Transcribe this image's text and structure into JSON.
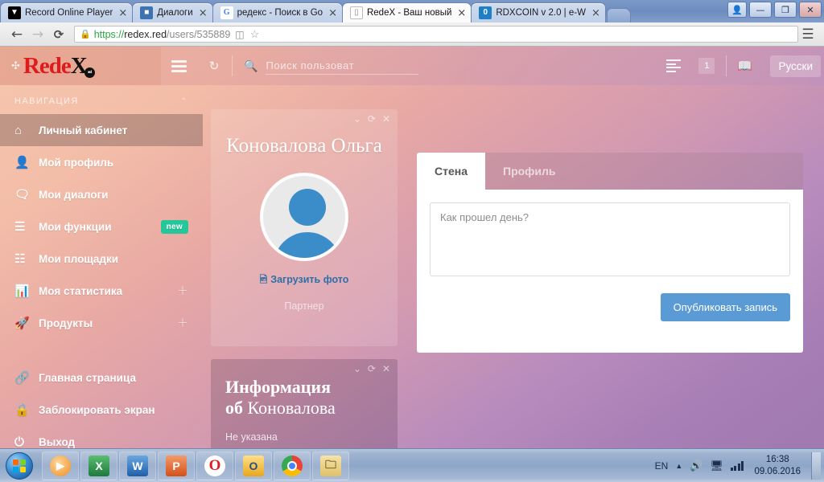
{
  "browser": {
    "tabs": [
      {
        "title": "Record Online Player",
        "favicon": "record-icon",
        "active": false
      },
      {
        "title": "Диалоги",
        "favicon": "dialog-icon",
        "active": false
      },
      {
        "title": "редекс - Поиск в Go",
        "favicon": "google-icon",
        "active": false
      },
      {
        "title": "RedeX - Ваш новый",
        "favicon": "document-icon",
        "active": true
      },
      {
        "title": "RDXCOIN v 2.0 | e-W",
        "favicon": "rdxcoin-icon",
        "active": false
      }
    ],
    "window_controls": {
      "user": "👤",
      "minimize": "—",
      "maximize": "❐",
      "close": "✕"
    },
    "nav": {
      "back": "←",
      "forward": "→",
      "reload": "⟳"
    },
    "url": {
      "scheme": "https://",
      "host": "redex.red",
      "path": "/users/535889"
    },
    "omnibox_icons": {
      "lock": "lock-icon",
      "split": "split-view-icon",
      "star": "bookmark-star-icon",
      "menu": "chrome-menu-icon"
    }
  },
  "header": {
    "logo": {
      "prefix": "Rede",
      "suffix": "X",
      "dot": "red"
    },
    "hamburger": "menu-icon",
    "refresh": "↻",
    "search": {
      "placeholder": "Поиск пользоват",
      "value": "",
      "icon": "search-icon"
    },
    "news_badge": "1",
    "language": "Русски"
  },
  "sidebar": {
    "title": "НАВИГАЦИЯ",
    "collapse": "⌃",
    "items": [
      {
        "label": "Личный кабинет",
        "icon": "home-icon",
        "active": true,
        "badge": "",
        "plus": false
      },
      {
        "label": "Мой профиль",
        "icon": "user-icon",
        "active": false,
        "badge": "",
        "plus": false
      },
      {
        "label": "Мои диалоги",
        "icon": "chat-icon",
        "active": false,
        "badge": "",
        "plus": false
      },
      {
        "label": "Мои функции",
        "icon": "list-icon",
        "active": false,
        "badge": "new",
        "plus": false
      },
      {
        "label": "Мои площадки",
        "icon": "grid-icon",
        "active": false,
        "badge": "",
        "plus": false
      },
      {
        "label": "Моя статистика",
        "icon": "chart-icon",
        "active": false,
        "badge": "",
        "plus": true
      },
      {
        "label": "Продукты",
        "icon": "rocket-icon",
        "active": false,
        "badge": "",
        "plus": true
      }
    ],
    "bottom_items": [
      {
        "label": "Главная страница",
        "icon": "link-icon"
      },
      {
        "label": "Заблокировать экран",
        "icon": "lock-icon"
      },
      {
        "label": "Выход",
        "icon": "power-icon"
      }
    ]
  },
  "profile_card": {
    "name": "Коновалова Ольга",
    "upload_label": "Загрузить фото",
    "upload_icon": "image-icon",
    "role": "Партнер",
    "tools": {
      "collapse": "⌄",
      "refresh": "⟳",
      "close": "✕"
    },
    "avatar": "default-avatar"
  },
  "info_card": {
    "title_bold": "Информация",
    "title_bold2": "об",
    "title_light": "Коновалова",
    "value": "Не указана",
    "tools": {
      "collapse": "⌄",
      "refresh": "⟳",
      "close": "✕"
    }
  },
  "wall": {
    "tabs": [
      {
        "label": "Стена",
        "active": true
      },
      {
        "label": "Профиль",
        "active": false
      }
    ],
    "textarea": {
      "placeholder": "Как прошел день?",
      "value": ""
    },
    "publish_label": "Опубликовать запись"
  },
  "taskbar": {
    "start": "windows-start-orb",
    "apps": [
      {
        "name": "media-player",
        "glyph": "▶"
      },
      {
        "name": "excel",
        "glyph": "X"
      },
      {
        "name": "word",
        "glyph": "W"
      },
      {
        "name": "powerpoint",
        "glyph": "P"
      },
      {
        "name": "opera",
        "glyph": "O"
      },
      {
        "name": "outlook",
        "glyph": "O"
      },
      {
        "name": "chrome",
        "glyph": ""
      },
      {
        "name": "explorer",
        "glyph": "🗀"
      }
    ],
    "tray": {
      "language": "EN",
      "chevron": "▲",
      "volume": "volume-icon",
      "network": "network-icon",
      "signal": "signal-icon",
      "time": "16:38",
      "date": "09.06.2016"
    }
  },
  "colors": {
    "accent_blue": "#5b9bd5",
    "logo_red": "#e01b1b",
    "badge_green": "#24c69a"
  }
}
